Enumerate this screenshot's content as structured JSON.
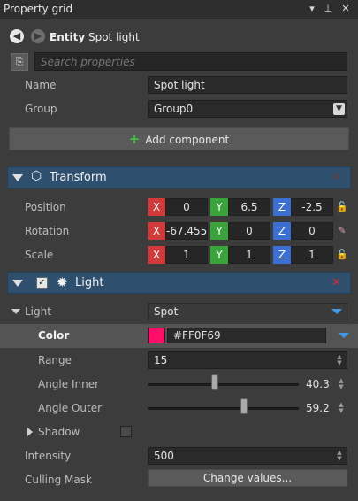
{
  "window": {
    "title": "Property grid",
    "menu_icon": "▾",
    "pin_icon": "⊥",
    "close_icon": "✕"
  },
  "entity": {
    "back_icon": "◀",
    "forward_icon": "▶",
    "prefix": "Entity",
    "name": "Spot light"
  },
  "search": {
    "placeholder": "Search properties"
  },
  "general": {
    "name_label": "Name",
    "name_value": "Spot light",
    "group_label": "Group",
    "group_value": "Group0",
    "add_component_label": "Add component"
  },
  "transform": {
    "title": "Transform",
    "rows": [
      {
        "label": "Position",
        "x": "0",
        "y": "6.5",
        "z": "-2.5"
      },
      {
        "label": "Rotation",
        "x": "-67.455",
        "y": "0",
        "z": "0"
      },
      {
        "label": "Scale",
        "x": "1",
        "y": "1",
        "z": "1"
      }
    ],
    "axis_tags": {
      "x": "X",
      "y": "Y",
      "z": "Z"
    }
  },
  "light": {
    "title": "Light",
    "enabled": true,
    "type_label": "Light",
    "type_value": "Spot",
    "color_label": "Color",
    "color_value": "#FF0F69",
    "range_label": "Range",
    "range_value": "15",
    "angle_inner_label": "Angle Inner",
    "angle_inner_value": "40.3",
    "angle_outer_label": "Angle Outer",
    "angle_outer_value": "59.2",
    "shadow_label": "Shadow",
    "intensity_label": "Intensity",
    "intensity_value": "500",
    "culling_mask_label": "Culling Mask",
    "culling_mask_button": "Change values..."
  },
  "colors": {
    "accent": "#3c9be8",
    "header": "#2e4f6d",
    "x_axis": "#d13a3a",
    "y_axis": "#3aa33a",
    "z_axis": "#3b6fd4",
    "remove": "#d03030"
  }
}
